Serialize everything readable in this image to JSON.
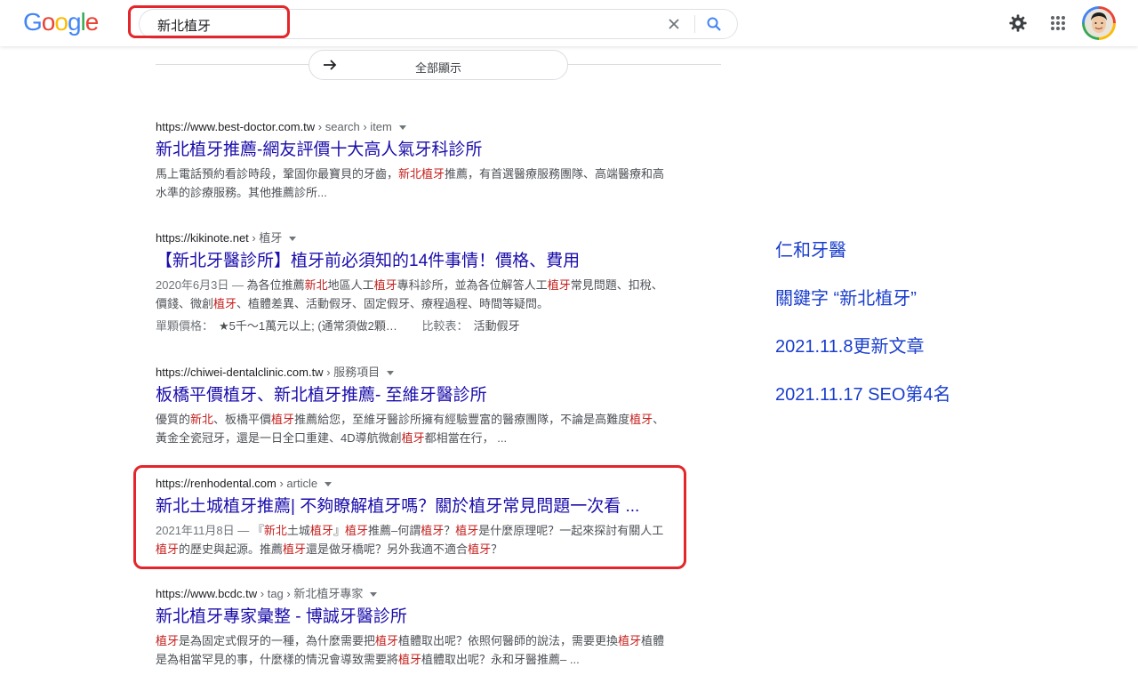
{
  "header": {
    "logo_letters": [
      {
        "ch": "G",
        "color": "#4285f4"
      },
      {
        "ch": "o",
        "color": "#ea4335"
      },
      {
        "ch": "o",
        "color": "#fbbc05"
      },
      {
        "ch": "g",
        "color": "#4285f4"
      },
      {
        "ch": "l",
        "color": "#34a853"
      },
      {
        "ch": "e",
        "color": "#ea4335"
      }
    ],
    "search_query": "新北植牙",
    "icons": {
      "clear": "close-icon",
      "search": "search-icon",
      "settings": "gear-icon",
      "apps": "apps-grid-icon",
      "account": "avatar"
    }
  },
  "show_all": {
    "label": "全部顯示"
  },
  "results": [
    {
      "site": "https://www.best-doctor.com.tw",
      "path": " › search › item",
      "title": "新北植牙推薦-網友評價十大高人氣牙科診所",
      "snippet": [
        {
          "t": "馬上電話預約看診時段，鞏固你最寶貝的牙齒，"
        },
        {
          "t": "新北植牙",
          "hl": true
        },
        {
          "t": "推薦，有首選醫療服務團隊、高端醫療和高水準的診療服務。其他推薦診所..."
        }
      ]
    },
    {
      "site": "https://kikinote.net",
      "path": " › 植牙",
      "title": "【新北牙醫診所】植牙前必須知的14件事情！價格、費用",
      "snippet": [
        {
          "t": "2020年6月3日 — ",
          "date": true
        },
        {
          "t": "為各位推薦"
        },
        {
          "t": "新北",
          "hl": true
        },
        {
          "t": "地區人工"
        },
        {
          "t": "植牙",
          "hl": true
        },
        {
          "t": "專科診所，並為各位解答人工"
        },
        {
          "t": "植牙",
          "hl": true
        },
        {
          "t": "常見問題、扣稅、價錢、微創"
        },
        {
          "t": "植牙",
          "hl": true
        },
        {
          "t": "、植體差異、活動假牙、固定假牙、療程過程、時間等疑問。"
        }
      ],
      "extra": {
        "label1": "單顆價格：",
        "value1": "★5千～1萬元以上; (通常須做2顆…",
        "label2": "比較表：",
        "value2": "活動假牙"
      }
    },
    {
      "site": "https://chiwei-dentalclinic.com.tw",
      "path": " › 服務項目",
      "title": "板橋平價植牙、新北植牙推薦- 至維牙醫診所",
      "snippet": [
        {
          "t": "優質的"
        },
        {
          "t": "新北",
          "hl": true
        },
        {
          "t": "、板橋平價"
        },
        {
          "t": "植牙",
          "hl": true
        },
        {
          "t": "推薦給您，至維牙醫診所擁有經驗豐富的醫療團隊，不論是高難度"
        },
        {
          "t": "植牙",
          "hl": true
        },
        {
          "t": "、黃金全瓷冠牙，還是一日全口重建、4D導航微創"
        },
        {
          "t": "植牙",
          "hl": true
        },
        {
          "t": "都相當在行， ..."
        }
      ]
    },
    {
      "site": "https://renhodental.com",
      "path": " › article",
      "title": "新北土城植牙推薦| 不夠瞭解植牙嗎？關於植牙常見問題一次看 ...",
      "snippet": [
        {
          "t": "2021年11月8日 — ",
          "date": true
        },
        {
          "t": "『"
        },
        {
          "t": "新北",
          "hl": true
        },
        {
          "t": "土城"
        },
        {
          "t": "植牙",
          "hl": true
        },
        {
          "t": "』"
        },
        {
          "t": "植牙",
          "hl": true
        },
        {
          "t": "推薦–何謂"
        },
        {
          "t": "植牙",
          "hl": true
        },
        {
          "t": "？"
        },
        {
          "t": "植牙",
          "hl": true
        },
        {
          "t": "是什麼原理呢？一起來探討有關人工"
        },
        {
          "t": "植牙",
          "hl": true
        },
        {
          "t": "的歷史與起源。推薦"
        },
        {
          "t": "植牙",
          "hl": true
        },
        {
          "t": "還是做牙橋呢？另外我適不適合"
        },
        {
          "t": "植牙",
          "hl": true
        },
        {
          "t": "？"
        }
      ]
    },
    {
      "site": "https://www.bcdc.tw",
      "path": " › tag › 新北植牙專家",
      "title": "新北植牙專家彙整 - 博誠牙醫診所",
      "snippet": [
        {
          "t": "植牙",
          "hl": true
        },
        {
          "t": "是為固定式假牙的一種，為什麼需要把"
        },
        {
          "t": "植牙",
          "hl": true
        },
        {
          "t": "植體取出呢？依照何醫師的說法，需要更換"
        },
        {
          "t": "植牙",
          "hl": true
        },
        {
          "t": "植體是為相當罕見的事，什麼樣的情況會導致需要將"
        },
        {
          "t": "植牙",
          "hl": true
        },
        {
          "t": "植體取出呢？永和牙醫推薦– ..."
        }
      ]
    }
  ],
  "notes": [
    "仁和牙醫",
    "關鍵字 “新北植牙”",
    "2021.11.8更新文章",
    "2021.11.17 SEO第4名"
  ],
  "colors": {
    "annotation_red": "#e3262b",
    "annotation_blue": "#1a3ecb",
    "link_blue": "#1a0dab",
    "keyword_red": "#c5221f"
  }
}
